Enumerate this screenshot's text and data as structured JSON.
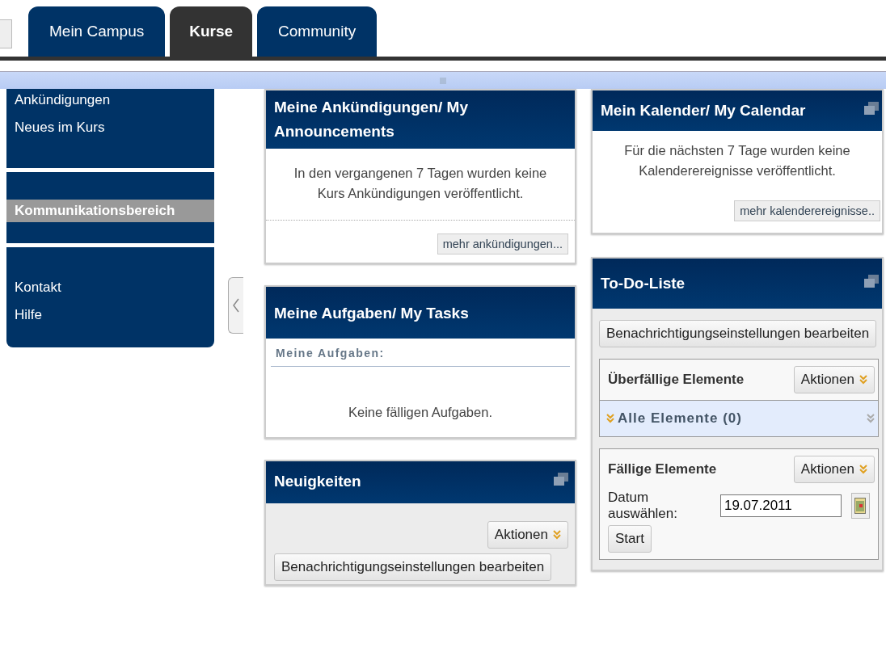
{
  "tabs": [
    {
      "label": "Mein Campus",
      "selected": false
    },
    {
      "label": "Kurse",
      "selected": true
    },
    {
      "label": "Community",
      "selected": false
    }
  ],
  "sidebar": {
    "groups": [
      {
        "items": [
          {
            "label": "Ankündigungen",
            "selected": false
          },
          {
            "label": "Neues im Kurs",
            "selected": false
          }
        ]
      },
      {
        "items": [
          {
            "label": "Kommunikationsbereich",
            "selected": true
          }
        ]
      },
      {
        "items": [
          {
            "label": "Kontakt",
            "selected": false
          },
          {
            "label": "Hilfe",
            "selected": false
          }
        ]
      }
    ]
  },
  "announcements": {
    "title": "Meine Ankündigungen/ My Announcements",
    "message": "In den vergangenen 7 Tagen wurden keine Kurs Ankündigungen veröffentlicht.",
    "more_button": "mehr ankündigungen..."
  },
  "tasks": {
    "title": "Meine Aufgaben/ My Tasks",
    "subtitle": "Meine Aufgaben:",
    "message": "Keine fälligen Aufgaben."
  },
  "news": {
    "title": "Neuigkeiten",
    "actions_button": "Aktionen",
    "settings_button": "Benachrichtigungseinstellungen bearbeiten"
  },
  "calendar": {
    "title": "Mein Kalender/ My Calendar",
    "message": "Für die nächsten 7 Tage wurden keine Kalenderereignisse veröffentlicht.",
    "more_button": "mehr kalenderereignisse.."
  },
  "todo": {
    "title": "To-Do-Liste",
    "settings_button": "Benachrichtigungseinstellungen bearbeiten",
    "overdue": {
      "title": "Überfällige Elemente",
      "actions_button": "Aktionen",
      "group_label": "Alle Elemente (0)"
    },
    "due": {
      "title": "Fällige Elemente",
      "actions_button": "Aktionen",
      "date_label": "Datum auswählen:",
      "date_value": "19.07.2011",
      "start_button": "Start"
    }
  }
}
